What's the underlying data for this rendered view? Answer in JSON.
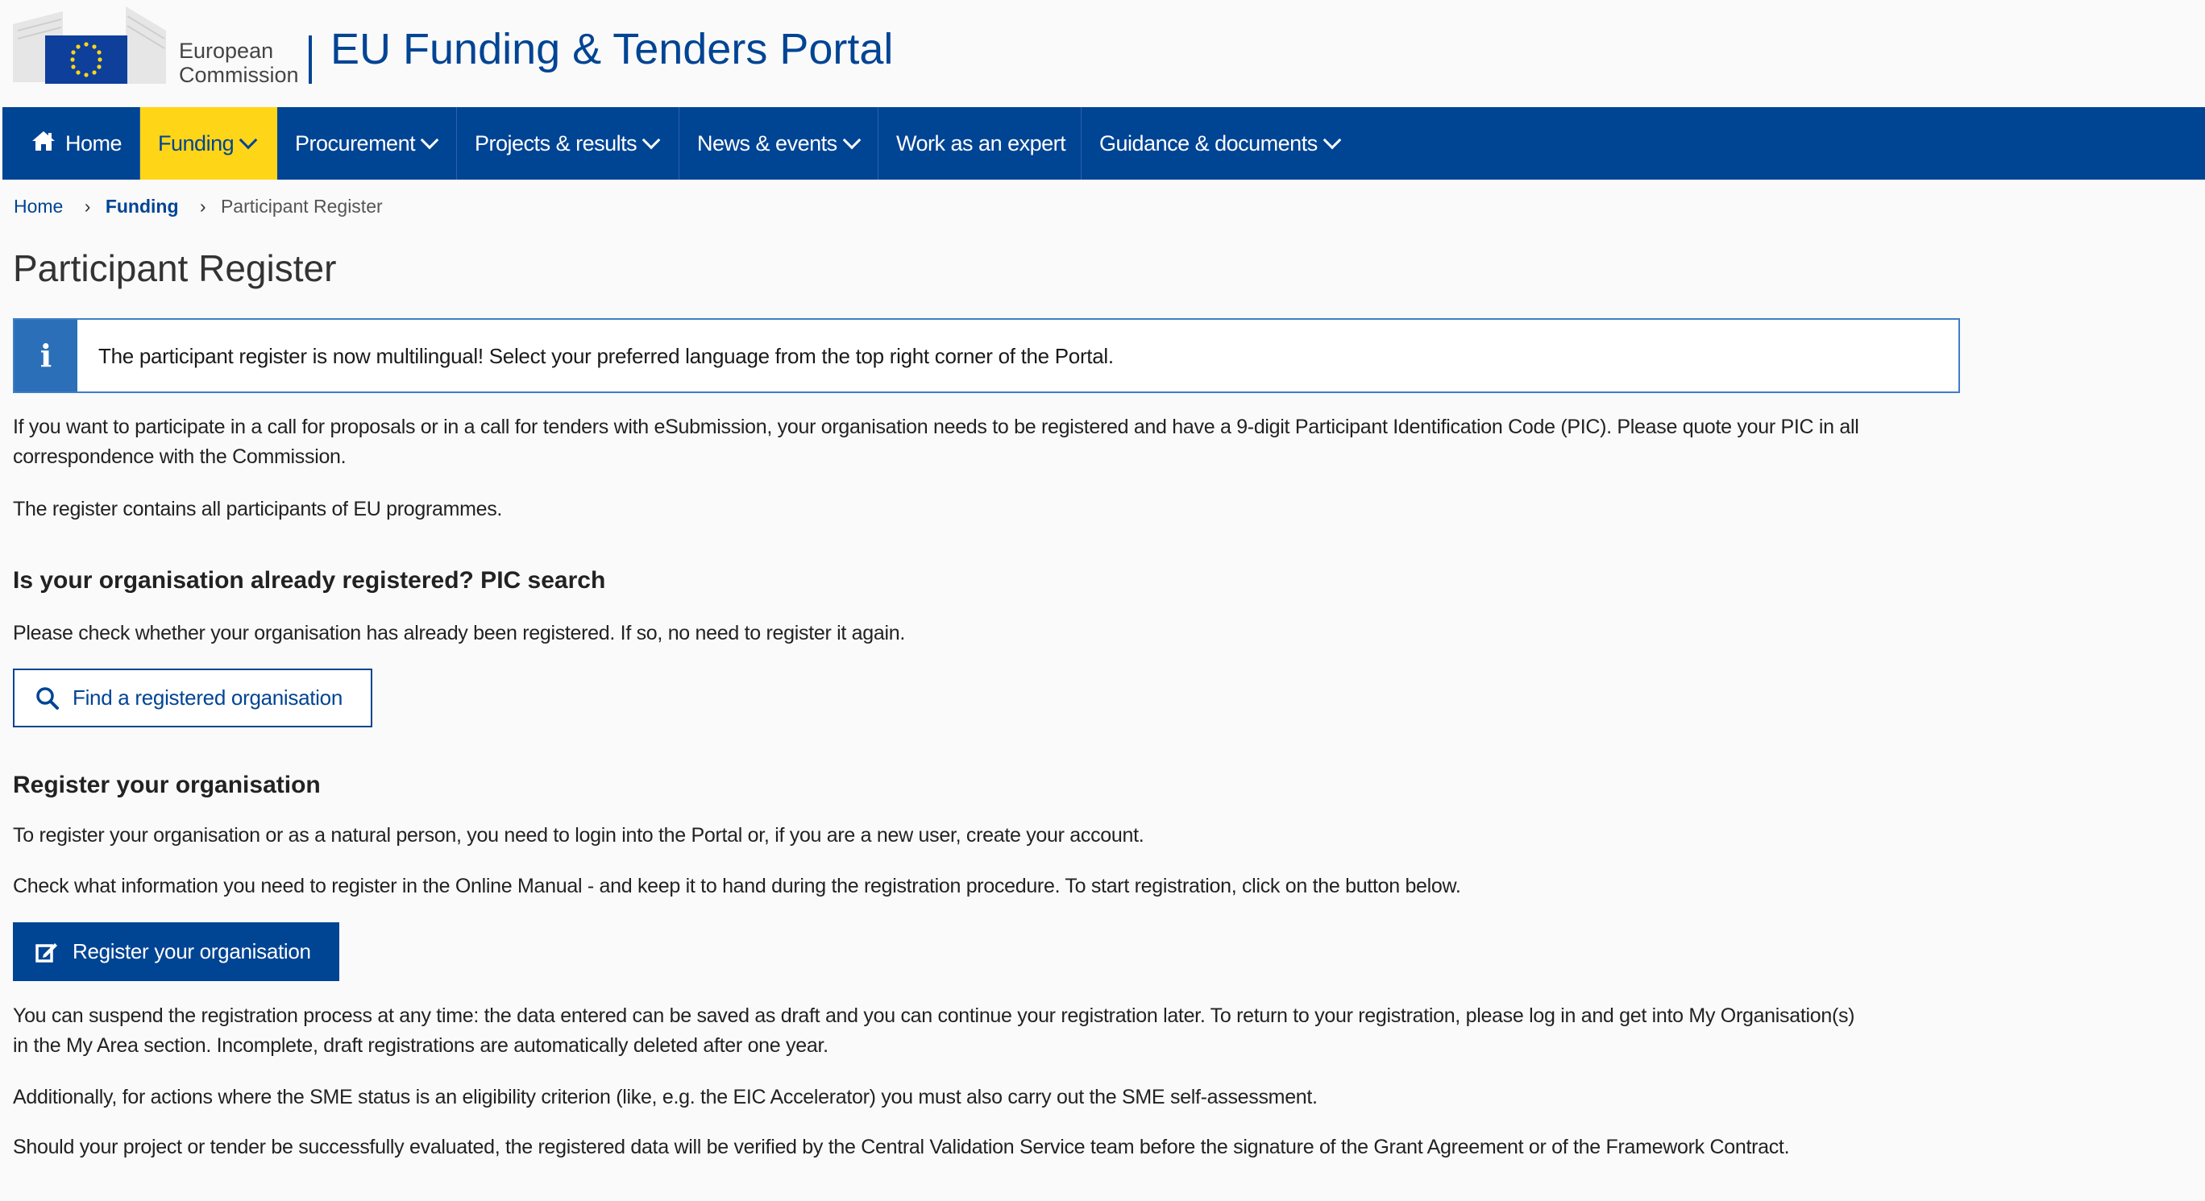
{
  "header": {
    "logo_text_line1": "European",
    "logo_text_line2": "Commission",
    "portal_title": "EU Funding & Tenders Portal"
  },
  "nav": {
    "items": [
      {
        "label": "Home",
        "icon": "home-icon"
      },
      {
        "label": "Funding",
        "dropdown": true,
        "active": true
      },
      {
        "label": "Procurement",
        "dropdown": true
      },
      {
        "label": "Projects & results",
        "dropdown": true
      },
      {
        "label": "News & events",
        "dropdown": true
      },
      {
        "label": "Work as an expert"
      },
      {
        "label": "Guidance & documents",
        "dropdown": true
      }
    ]
  },
  "breadcrumb": {
    "items": [
      "Home",
      "Funding",
      "Participant Register"
    ]
  },
  "page": {
    "title": "Participant Register",
    "info": "The participant register is now multilingual! Select your preferred language from the top right corner of the Portal.",
    "intro_p1": "If you want to participate in a call for proposals or in a call for tenders with eSubmission, your organisation needs to be registered and have a 9-digit Participant Identification Code (PIC). Please quote your PIC in all correspondence with the Commission.",
    "intro_p2": "The register contains all participants of EU programmes.",
    "pic_heading": "Is your organisation already registered? PIC search",
    "pic_text": "Please check whether your organisation has already been registered. If so, no need to register it again.",
    "find_button": "Find a registered organisation",
    "register_heading": "Register your organisation",
    "register_p1": "To register your organisation or as a natural person, you need to login into the Portal or, if you are a new user, create your account.",
    "register_p2": "Check what information you need to register in the Online Manual - and keep it to hand during the registration procedure. To start registration, click on the button below.",
    "register_button": "Register your organisation",
    "suspend_p": "You can suspend the registration process at any time: the data entered can be saved as draft and you can continue your registration later. To return to your registration, please log in and get into My Organisation(s) in the My Area section. Incomplete, draft registrations are automatically deleted after one year.",
    "sme_p": "Additionally, for actions where the SME status is an eligibility criterion (like, e.g. the EIC Accelerator) you must also carry out the SME self-assessment.",
    "validation_p": "Should your project or tender be successfully evaluated, the registered data will be verified by the Central Validation Service team before the signature of the Grant Agreement or of the Framework Contract."
  },
  "colors": {
    "brand_blue": "#004494",
    "active_yellow": "#ffd617",
    "info_blue": "#2a6fb7"
  }
}
